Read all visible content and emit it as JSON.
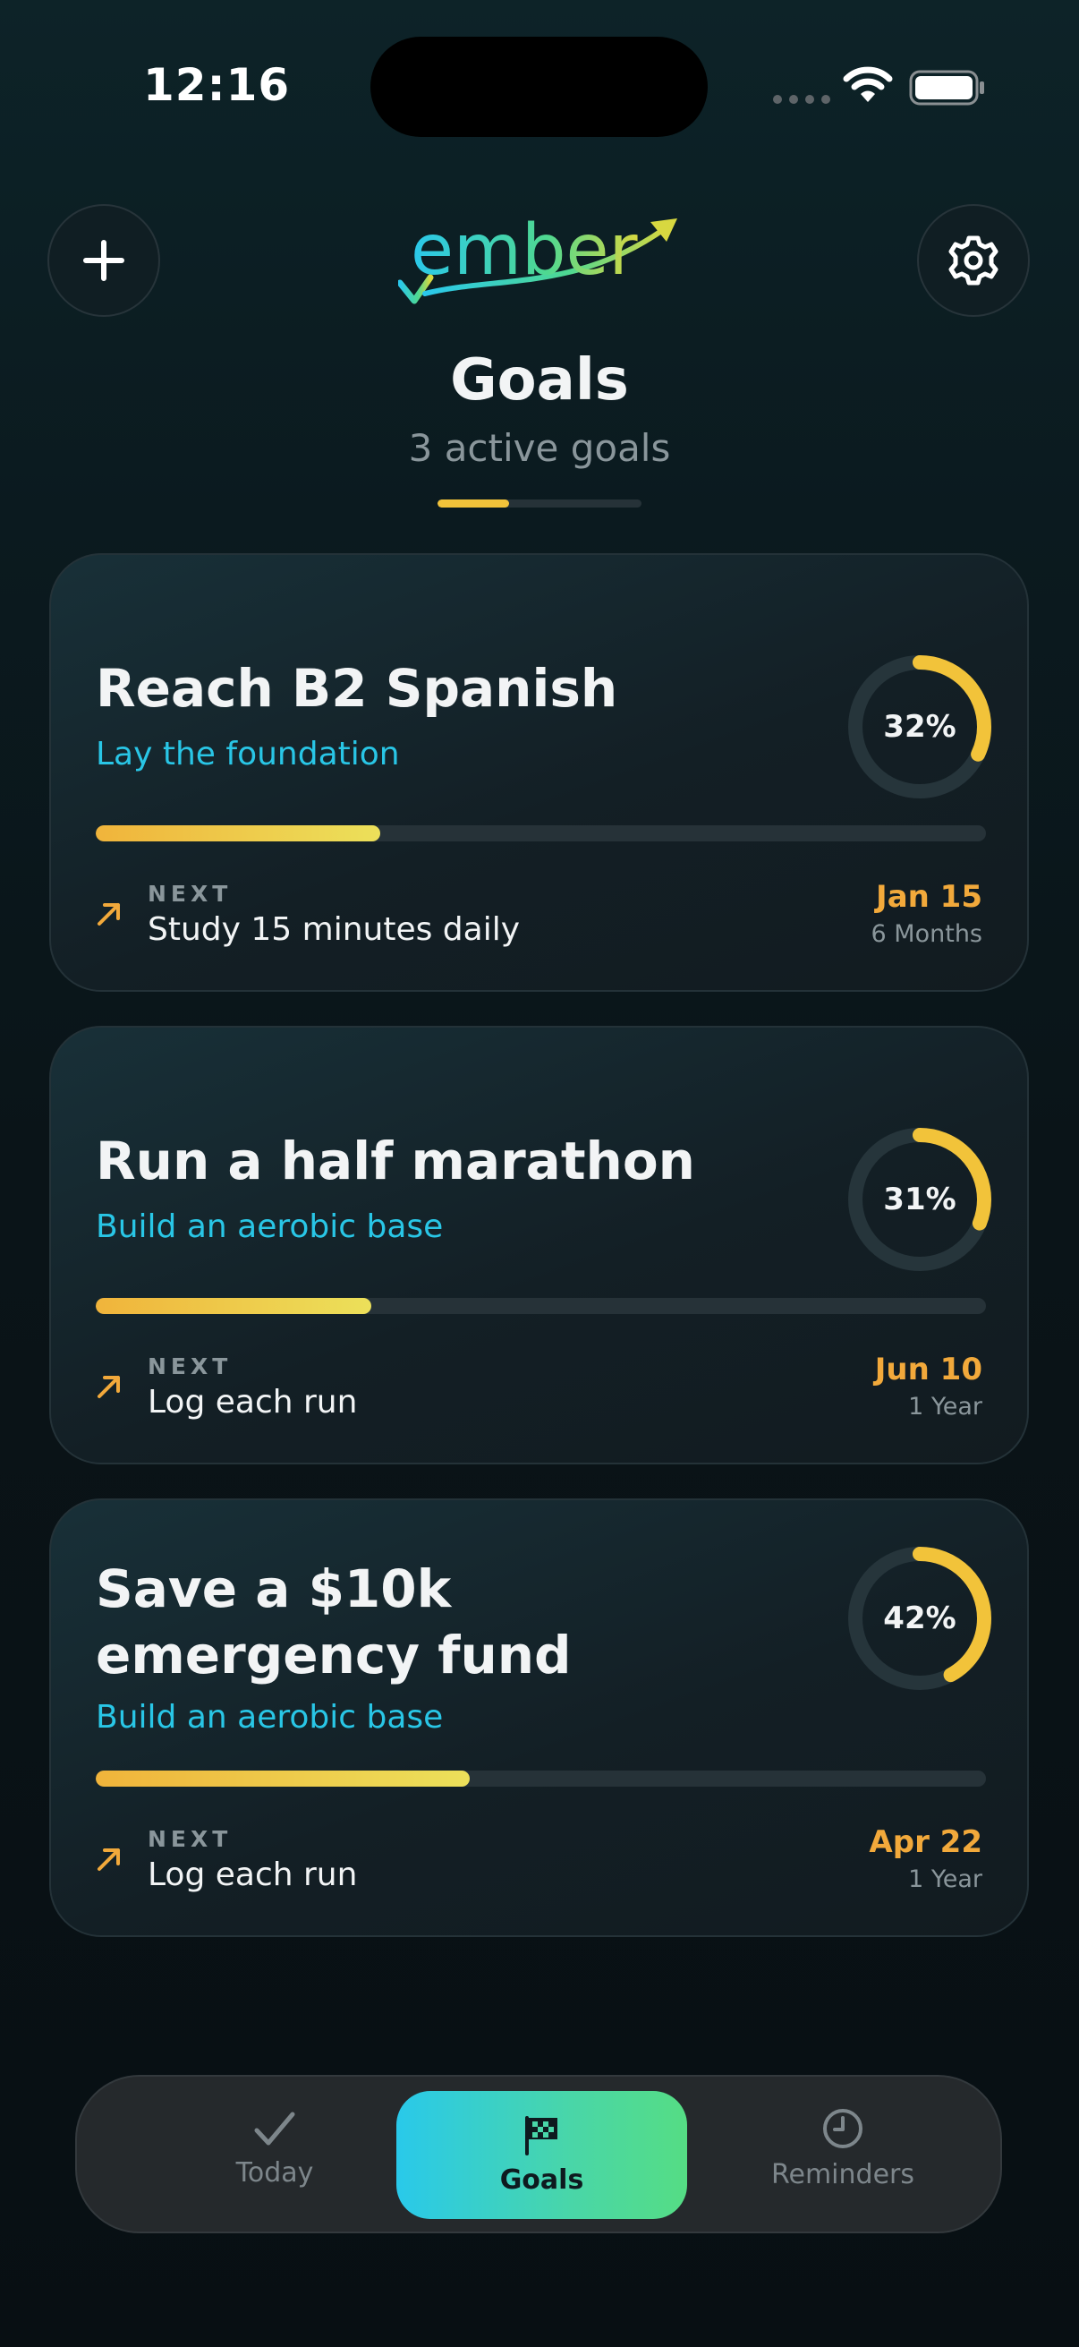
{
  "status_bar": {
    "time": "12:16",
    "icons": [
      "signal-dots-icon",
      "wifi-icon",
      "battery-icon"
    ]
  },
  "header": {
    "logo_text": "ember",
    "title": "Goals",
    "subtitle": "3 active goals",
    "indicator_progress": 0.35,
    "add_icon": "plus-icon",
    "settings_icon": "gear-icon"
  },
  "colors": {
    "accent_yellow": "#f2c33a",
    "accent_cyan": "#29c6e6",
    "accent_orange": "#f2a93b",
    "accent_green": "#55dd84"
  },
  "goals": [
    {
      "title": "Reach B2 Spanish",
      "subtitle": "Lay the foundation",
      "percent_label": "32%",
      "progress": 0.32,
      "next_label": "NEXT",
      "next_action": "Study 15 minutes daily",
      "due_date": "Jan 15",
      "duration": "6 Months"
    },
    {
      "title": "Run a half marathon",
      "subtitle": "Build an aerobic base",
      "percent_label": "31%",
      "progress": 0.31,
      "next_label": "NEXT",
      "next_action": "Log each run",
      "due_date": "Jun 10",
      "duration": "1 Year"
    },
    {
      "title": "Save a $10k emergency fund",
      "subtitle": "Build an aerobic base",
      "percent_label": "42%",
      "progress": 0.42,
      "next_label": "NEXT",
      "next_action": "Log each run",
      "due_date": "Apr 22",
      "duration": "1 Year"
    }
  ],
  "tabbar": {
    "tabs": [
      {
        "label": "Today",
        "icon": "checkmark-icon",
        "selected": false
      },
      {
        "label": "Goals",
        "icon": "checkered-flag-icon",
        "selected": true
      },
      {
        "label": "Reminders",
        "icon": "clock-icon",
        "selected": false
      }
    ]
  }
}
